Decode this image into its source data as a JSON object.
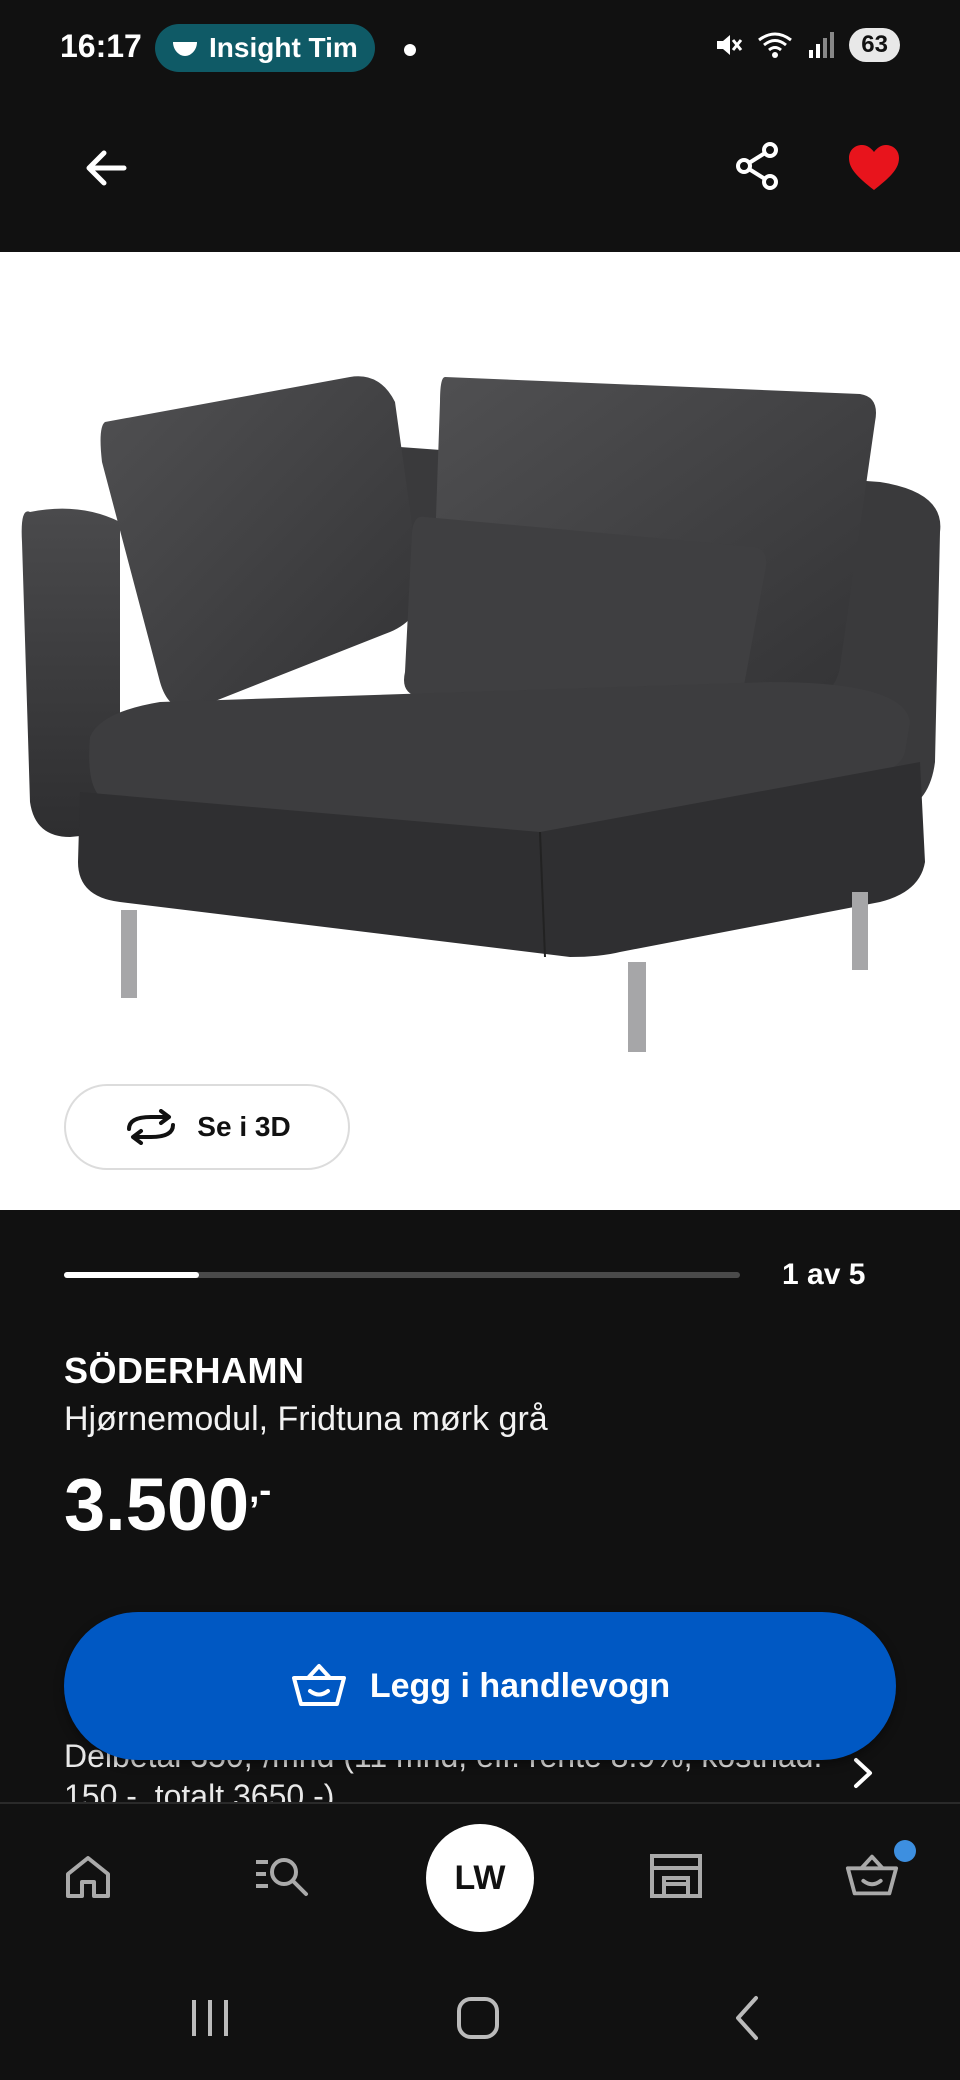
{
  "status_bar": {
    "time": "16:17",
    "notification_pill": "Insight Tim",
    "battery": "63"
  },
  "app_bar": {
    "back_icon": "arrow-left-icon",
    "share_icon": "share-icon",
    "favorite_icon": "heart-filled-icon",
    "favorite_color": "#e8141c"
  },
  "gallery": {
    "view_3d_label": "Se i 3D",
    "page_indicator": "1 av 5",
    "progress_fraction": 0.2
  },
  "product": {
    "name": "SÖDERHAMN",
    "description": "Hjørnemodul, Fridtuna mørk grå",
    "price": "3.500",
    "price_suffix": ",-",
    "financing": "Delbetal 350,-/mnd (11 mnd, eff. rente 8.9%, kostnad: 150,-, totalt 3650,-)"
  },
  "cart_button": {
    "label": "Legg i handlevogn",
    "color": "#0058c3"
  },
  "bottom_nav": {
    "home_icon": "home-icon",
    "search_icon": "search-list-icon",
    "avatar_initials": "LW",
    "store_icon": "store-icon",
    "cart_icon": "basket-icon"
  },
  "system_nav": {
    "recents_icon": "recents-icon",
    "home_icon": "system-home-icon",
    "back_icon": "system-back-icon"
  }
}
